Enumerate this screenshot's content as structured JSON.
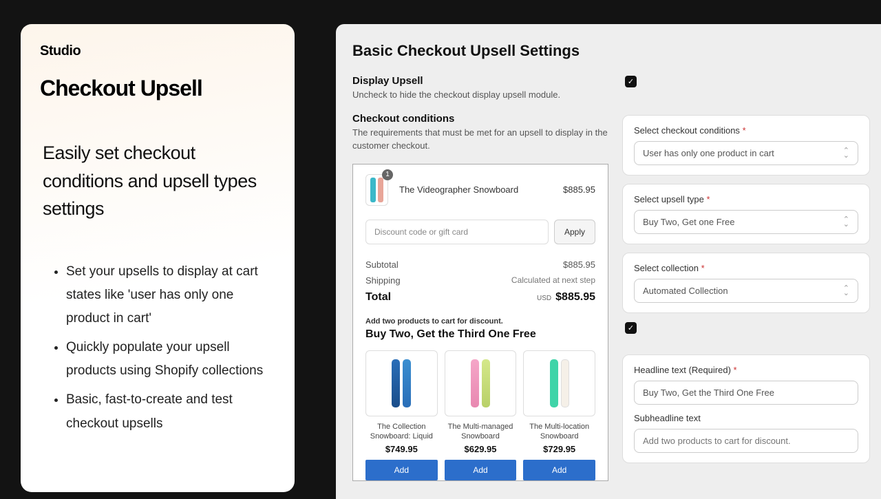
{
  "sidebar": {
    "brand": "Studio",
    "title": "Checkout Upsell",
    "subtitle": "Easily set checkout conditions and upsell types settings",
    "bullets": [
      "Set your upsells to display at cart states like 'user has only one product in cart'",
      "Quickly populate your upsell products using Shopify collections",
      "Basic, fast-to-create and test checkout upsells"
    ]
  },
  "main": {
    "title": "Basic Checkout Upsell Settings",
    "display_upsell": {
      "label": "Display Upsell",
      "desc": "Uncheck to hide the checkout display upsell module."
    },
    "checkout_conditions_section": {
      "label": "Checkout conditions",
      "desc": "The requirements that must be met for an upsell to display in the customer checkout."
    },
    "fields": {
      "checkout_conditions": {
        "label": "Select checkout conditions",
        "value": "User has only one product in cart"
      },
      "upsell_type": {
        "label": "Select upsell type",
        "value": "Buy Two, Get one Free"
      },
      "collection": {
        "label": "Select collection",
        "value": "Automated Collection"
      },
      "headline": {
        "label": "Headline text (Required)",
        "value": "Buy Two, Get the Third One Free"
      },
      "subheadline": {
        "label": "Subheadline text",
        "placeholder": "Add two products to cart for discount."
      }
    },
    "preview": {
      "cart": {
        "qty": "1",
        "product": "The Videographer Snowboard",
        "price": "$885.95",
        "discount_placeholder": "Discount code or gift card",
        "apply": "Apply"
      },
      "totals": {
        "subtotal_label": "Subtotal",
        "subtotal": "$885.95",
        "shipping_label": "Shipping",
        "shipping": "Calculated at next step",
        "total_label": "Total",
        "currency": "USD",
        "total": "$885.95"
      },
      "upsell": {
        "subhead": "Add two products to cart for discount.",
        "headline": "Buy Two, Get the Third One Free",
        "products": [
          {
            "name": "The Collection Snowboard: Liquid",
            "price": "$749.95",
            "add": "Add"
          },
          {
            "name": "The Multi-managed Snowboard",
            "price": "$629.95",
            "add": "Add"
          },
          {
            "name": "The Multi-location Snowboard",
            "price": "$729.95",
            "add": "Add"
          }
        ]
      }
    }
  }
}
